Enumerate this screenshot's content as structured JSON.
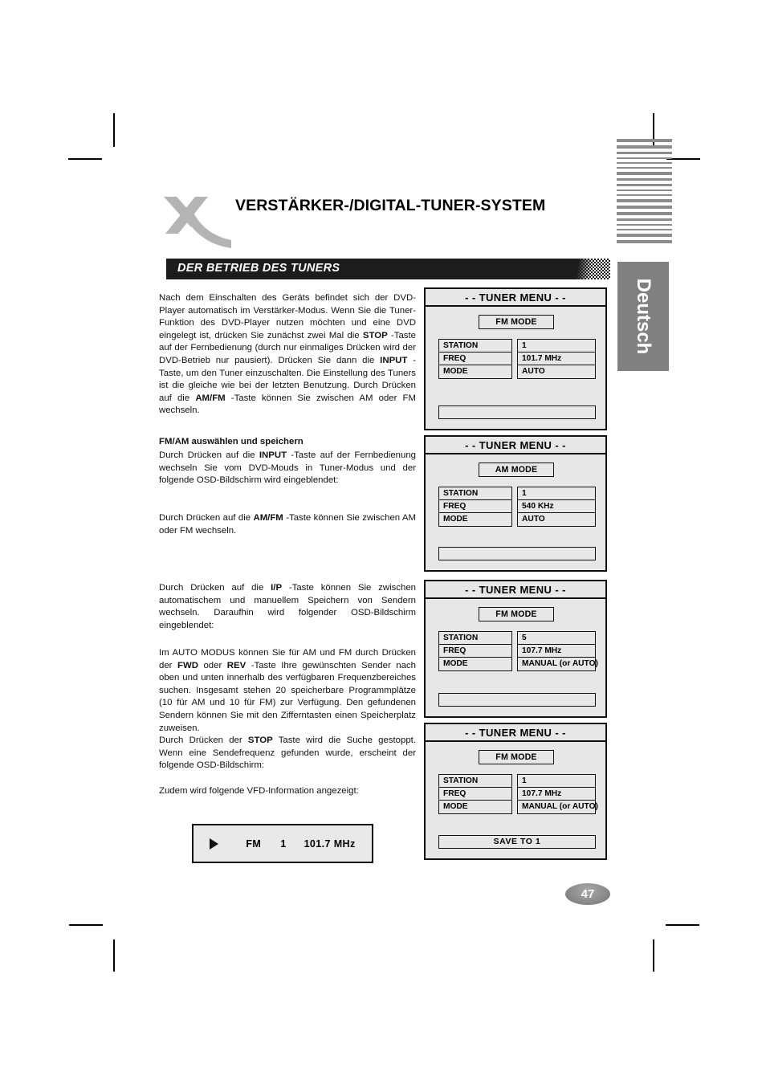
{
  "document": {
    "title": "VERSTÄRKER-/DIGITAL-TUNER-SYSTEM",
    "section_heading": "DER BETRIEB DES TUNERS",
    "language_tab": "Deutsch",
    "page_number": "47"
  },
  "body": {
    "intro": "Nach dem Einschalten des Geräts befindet sich der DVD-Player automatisch im Verstärker-Modus. Wenn Sie die Tuner-Funktion des DVD-Player nutzen möchten und eine DVD eingelegt ist, drücken Sie zunächst zwei Mal die STOP -Taste auf der Fernbedienung (durch nur einmaliges Drücken wird der DVD-Betrieb nur pausiert). Drücken Sie dann die INPUT -Taste, um den Tuner einzuschalten. Die Einstellung des Tuners ist die gleiche wie bei der letzten Benutzung. Durch Drücken auf die AM/FM -Taste können Sie zwischen AM oder FM wechseln.",
    "subheading_fmam": "FM/AM  auswählen und speichern",
    "para_fmam_1": "Durch Drücken auf die INPUT -Taste auf der Fernbedienung wechseln Sie vom DVD-Mouds in Tuner-Modus und der folgende OSD-Bildschirm wird eingeblendet:",
    "para_fmam_2": "Durch Drücken auf die AM/FM -Taste können Sie zwischen AM oder FM wechseln.",
    "para_ip": "Durch Drücken auf die I/P -Taste können Sie zwischen automatischem und manuellem Speichern von Sendern wechseln. Daraufhin wird folgender OSD-Bildschirm eingeblendet:",
    "para_auto": "Im AUTO MODUS können Sie für AM und FM durch Drücken der FWD oder REV -Taste Ihre gewünschten Sender nach oben und unten innerhalb des verfügbaren Frequenzbereiches suchen. Insgesamt stehen 20 speicherbare Programmplätze (10 für AM und 10 für FM) zur Verfügung. Den gefundenen Sendern können Sie mit den Zifferntasten einen Speicherplatz zuweisen.",
    "para_stop": "Durch Drücken der STOP Taste wird die Suche gestoppt. Wenn eine Sendefrequenz gefunden wurde, erscheint der folgende OSD-Bildschirm:",
    "para_vfd": "Zudem wird folgende VFD-Information angezeigt:"
  },
  "vfd_display": {
    "play_icon": "play-triangle-icon",
    "band": "FM",
    "station": "1",
    "frequency": "101.7 MHz"
  },
  "osd_screens": [
    {
      "title": "- - TUNER MENU - -",
      "mode_badge": "FM MODE",
      "rows": [
        {
          "label": "STATION",
          "value": "1"
        },
        {
          "label": "FREQ",
          "value": "101.7 MHz"
        },
        {
          "label": "MODE",
          "value": "AUTO"
        }
      ],
      "status": ""
    },
    {
      "title": "- - TUNER MENU - -",
      "mode_badge": "AM MODE",
      "rows": [
        {
          "label": "STATION",
          "value": "1"
        },
        {
          "label": "FREQ",
          "value": "540 KHz"
        },
        {
          "label": "MODE",
          "value": "AUTO"
        }
      ],
      "status": ""
    },
    {
      "title": "- - TUNER MENU - -",
      "mode_badge": "FM MODE",
      "rows": [
        {
          "label": "STATION",
          "value": "5"
        },
        {
          "label": "FREQ",
          "value": "107.7 MHz"
        },
        {
          "label": "MODE",
          "value": "MANUAL (or AUTO)"
        }
      ],
      "status": ""
    },
    {
      "title": "- - TUNER MENU - -",
      "mode_badge": "FM MODE",
      "rows": [
        {
          "label": "STATION",
          "value": "1"
        },
        {
          "label": "FREQ",
          "value": "107.7 MHz"
        },
        {
          "label": "MODE",
          "value": "MANUAL (or AUTO)"
        }
      ],
      "status": "SAVE  TO  1"
    }
  ],
  "emphasis_terms": [
    "STOP",
    "INPUT",
    "AM/FM",
    "I/P",
    "FWD",
    "REV"
  ],
  "colors": {
    "section_bar": "#1c1c1c",
    "language_tab": "#808080",
    "logo_gray": "#b4b4b4",
    "osd_background": "#e7e7e7",
    "page_badge": "#8d8d8d"
  }
}
